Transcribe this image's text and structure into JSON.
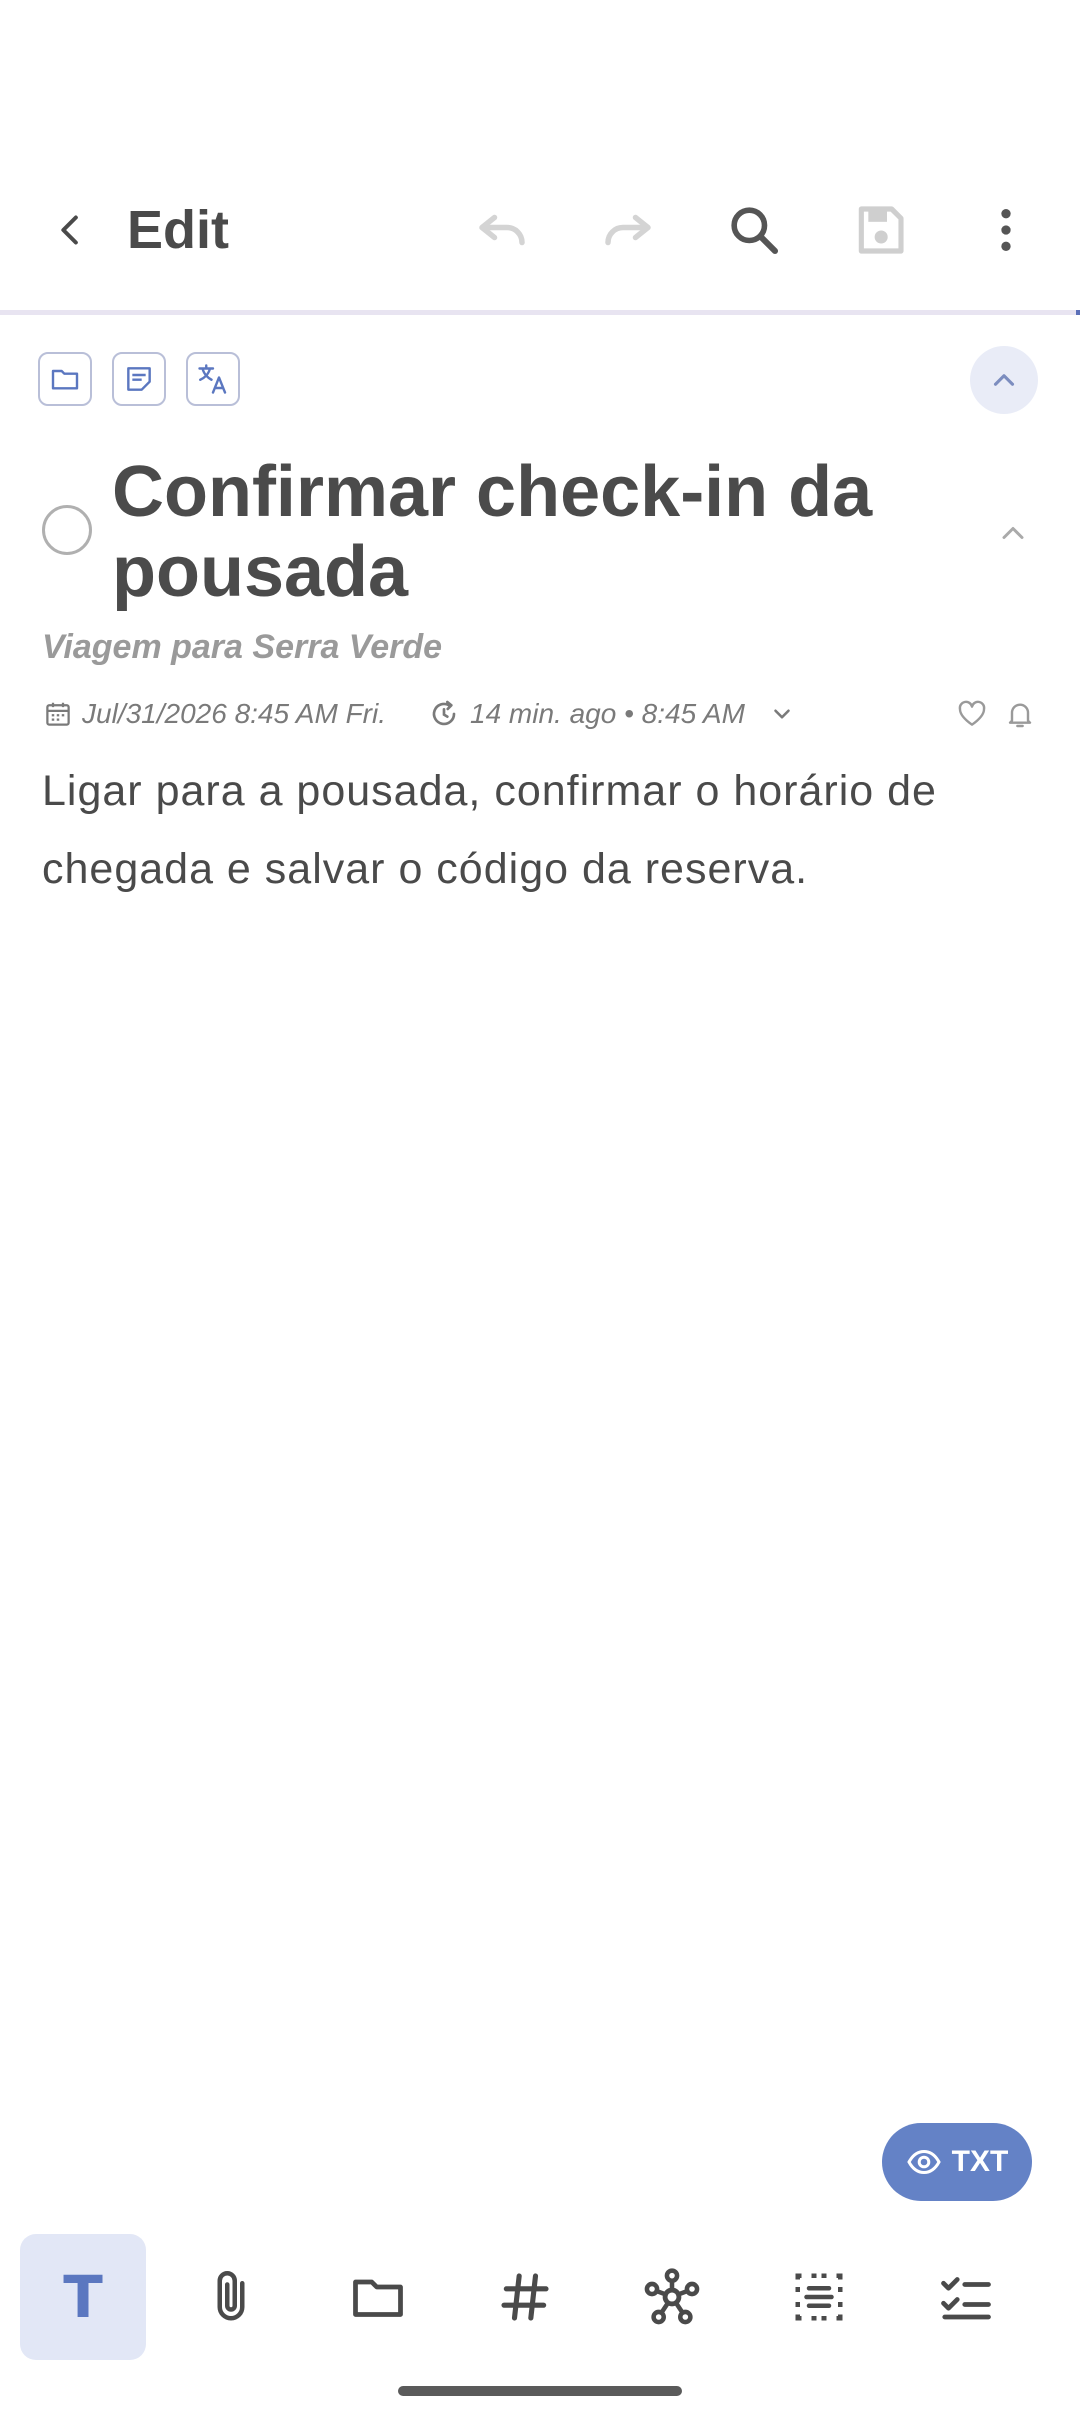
{
  "header": {
    "title": "Edit"
  },
  "task": {
    "title": "Confirmar check-in da pousada",
    "subtitle": "Viagem para Serra Verde",
    "date": "Jul/31/2026 8:45 AM Fri.",
    "updated": "14 min. ago • 8:45 AM",
    "body": "Ligar para a pousada, confirmar o horário de chegada e salvar o código da reserva."
  },
  "view_mode": {
    "label": "TXT"
  },
  "colors": {
    "accent": "#6482c6",
    "accent_light": "#e2e7f6",
    "text_dark": "#4a4a4a",
    "text_muted": "#9a9a9a"
  }
}
